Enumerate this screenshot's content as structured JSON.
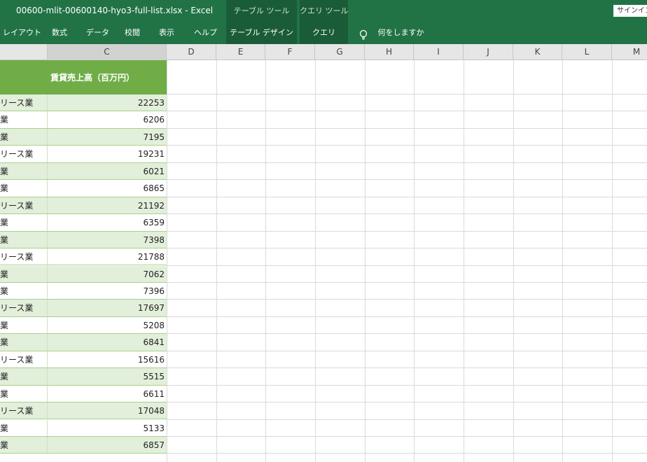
{
  "window": {
    "title": "00600-mlit-00600140-hyo3-full-list.xlsx  -  Excel",
    "signin_label": "サインイン"
  },
  "context_tabs": {
    "table_tools": "テーブル ツール",
    "query_tools": "クエリ ツール"
  },
  "ribbon": {
    "tabs": [
      {
        "label": "レイアウト"
      },
      {
        "label": "数式"
      },
      {
        "label": "データ"
      },
      {
        "label": "校閲"
      },
      {
        "label": "表示"
      },
      {
        "label": "ヘルプ"
      },
      {
        "label": "テーブル デザイン"
      },
      {
        "label": "クエリ"
      }
    ],
    "tell_me": "何をしますか"
  },
  "columns": [
    {
      "letter": "C"
    },
    {
      "letter": "D"
    },
    {
      "letter": "E"
    },
    {
      "letter": "F"
    },
    {
      "letter": "G"
    },
    {
      "letter": "H"
    },
    {
      "letter": "I"
    },
    {
      "letter": "J"
    },
    {
      "letter": "K"
    },
    {
      "letter": "L"
    },
    {
      "letter": "M"
    }
  ],
  "table": {
    "header_c": "賃貸売上高（百万円）",
    "rows": [
      {
        "b": "リース業",
        "c": "22253"
      },
      {
        "b": "業",
        "c": "6206"
      },
      {
        "b": "業",
        "c": "7195"
      },
      {
        "b": "リース業",
        "c": "19231"
      },
      {
        "b": "業",
        "c": "6021"
      },
      {
        "b": "業",
        "c": "6865"
      },
      {
        "b": "リース業",
        "c": "21192"
      },
      {
        "b": "業",
        "c": "6359"
      },
      {
        "b": "業",
        "c": "7398"
      },
      {
        "b": "リース業",
        "c": "21788"
      },
      {
        "b": "業",
        "c": "7062"
      },
      {
        "b": "業",
        "c": "7396"
      },
      {
        "b": "リース業",
        "c": "17697"
      },
      {
        "b": "業",
        "c": "5208"
      },
      {
        "b": "業",
        "c": "6841"
      },
      {
        "b": "リース業",
        "c": "15616"
      },
      {
        "b": "業",
        "c": "5515"
      },
      {
        "b": "業",
        "c": "6611"
      },
      {
        "b": "リース業",
        "c": "17048"
      },
      {
        "b": "業",
        "c": "5133"
      },
      {
        "b": "業",
        "c": "6857"
      }
    ]
  },
  "colors": {
    "excel_green": "#217346",
    "table_header": "#70ad47",
    "band": "#e2efda"
  }
}
